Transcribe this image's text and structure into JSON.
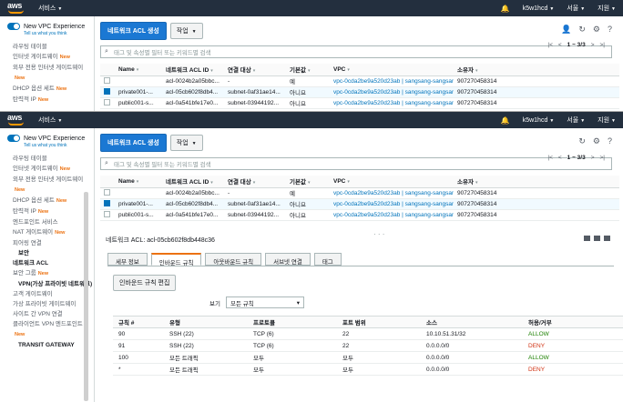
{
  "nav": {
    "logo": "aws",
    "services": "서비스",
    "user": "k5w1hcd",
    "region": "서울",
    "support": "지원"
  },
  "sidebar": {
    "toggle_label": "New VPC Experience",
    "toggle_sub": "Tell us what you think",
    "new_badge": "New",
    "items_top": [
      {
        "label": "라우팅 테이블",
        "new": false
      },
      {
        "label": "인터넷 게이트웨이",
        "new": true
      },
      {
        "label": "외부 전용 인터넷 게이트웨이",
        "new": true
      },
      {
        "label": "DHCP 옵션 세트",
        "new": true
      },
      {
        "label": "탄력적 IP",
        "new": true
      }
    ],
    "items": [
      {
        "label": "라우팅 테이블",
        "new": false,
        "type": "item"
      },
      {
        "label": "인터넷 게이트웨이",
        "new": true,
        "type": "item"
      },
      {
        "label": "외부 전용 인터넷 게이트웨이",
        "new": true,
        "type": "item"
      },
      {
        "label": "DHCP 옵션 세트",
        "new": true,
        "type": "item"
      },
      {
        "label": "탄력적 IP",
        "new": true,
        "type": "item"
      },
      {
        "label": "엔드포인트 서비스",
        "new": false,
        "type": "item"
      },
      {
        "label": "NAT 게이트웨이",
        "new": true,
        "type": "item"
      },
      {
        "label": "피어링 연결",
        "new": false,
        "type": "item"
      },
      {
        "label": "보안",
        "new": false,
        "type": "section"
      },
      {
        "label": "네트워크 ACL",
        "new": false,
        "type": "active"
      },
      {
        "label": "보안 그룹",
        "new": true,
        "type": "item"
      },
      {
        "label": "VPN(가상 프라이빗 네트워크)",
        "new": false,
        "type": "section"
      },
      {
        "label": "고객 게이트웨이",
        "new": false,
        "type": "item"
      },
      {
        "label": "가상 프라이빗 게이트웨이",
        "new": false,
        "type": "item"
      },
      {
        "label": "사이트 간 VPN 연결",
        "new": false,
        "type": "item"
      },
      {
        "label": "클라이언트 VPN 엔드포인트",
        "new": true,
        "type": "item"
      },
      {
        "label": "TRANSIT GATEWAY",
        "new": false,
        "type": "section"
      }
    ]
  },
  "toolbar": {
    "create_label": "네트워크 ACL 생성",
    "actions_label": "작업"
  },
  "search": {
    "placeholder": "태그 및 속성별 필터 또는 키워드별 검색"
  },
  "pager": {
    "text": "1 ~ 3/3"
  },
  "acl_table": {
    "columns": [
      "Name",
      "네트워크 ACL ID",
      "연결 대상",
      "기본값",
      "VPC",
      "소유자"
    ],
    "rows": [
      {
        "name": "",
        "id": "acl-0024b2a05bbc...",
        "assoc": "-",
        "default": "예",
        "vpc": "vpc-0cda2be9a520d23ab | sangsang-sangsang-...",
        "owner": "907270458314",
        "selected": false
      },
      {
        "name": "private001-...",
        "id": "acl-05cb602f8db4...",
        "assoc": "subnet-0af31ae14...",
        "default": "아니요",
        "vpc": "vpc-0cda2be9a520d23ab | sangsang-sangsang-...",
        "owner": "907270458314",
        "selected": true
      },
      {
        "name": "public001-s...",
        "id": "acl-0a541bfe17e0...",
        "assoc": "subnet-03944192...",
        "default": "아니요",
        "vpc": "vpc-0cda2be9a520d23ab | sangsang-sangsang-...",
        "owner": "907270458314",
        "selected": false
      }
    ]
  },
  "detail": {
    "title": "네트워크 ACL: acl-05cb602f8db448c36",
    "tabs": [
      "세부 정보",
      "인바운드 규칙",
      "아웃바운드 규칙",
      "서브넷 연결",
      "태그"
    ],
    "active_tab": 1,
    "edit_label": "인바운드 규칙 편집",
    "view_label": "보기",
    "view_value": "모든 규칙",
    "rules_columns": [
      "규칙 #",
      "유형",
      "프로토콜",
      "포트 범위",
      "소스",
      "허용/거부"
    ],
    "rules": [
      {
        "num": "90",
        "type": "SSH (22)",
        "proto": "TCP (6)",
        "port": "22",
        "source": "10.10.51.31/32",
        "action": "ALLOW"
      },
      {
        "num": "91",
        "type": "SSH (22)",
        "proto": "TCP (6)",
        "port": "22",
        "source": "0.0.0.0/0",
        "action": "DENY"
      },
      {
        "num": "100",
        "type": "모든 트래픽",
        "proto": "모두",
        "port": "모두",
        "source": "0.0.0.0/0",
        "action": "ALLOW"
      },
      {
        "num": "*",
        "type": "모든 트래픽",
        "proto": "모두",
        "port": "모두",
        "source": "0.0.0.0/0",
        "action": "DENY"
      }
    ]
  },
  "colors": {
    "nav_bg": "#232f3e",
    "primary": "#1b78d3",
    "allow": "#1d8102",
    "deny": "#d13212",
    "new": "#ec7211"
  }
}
